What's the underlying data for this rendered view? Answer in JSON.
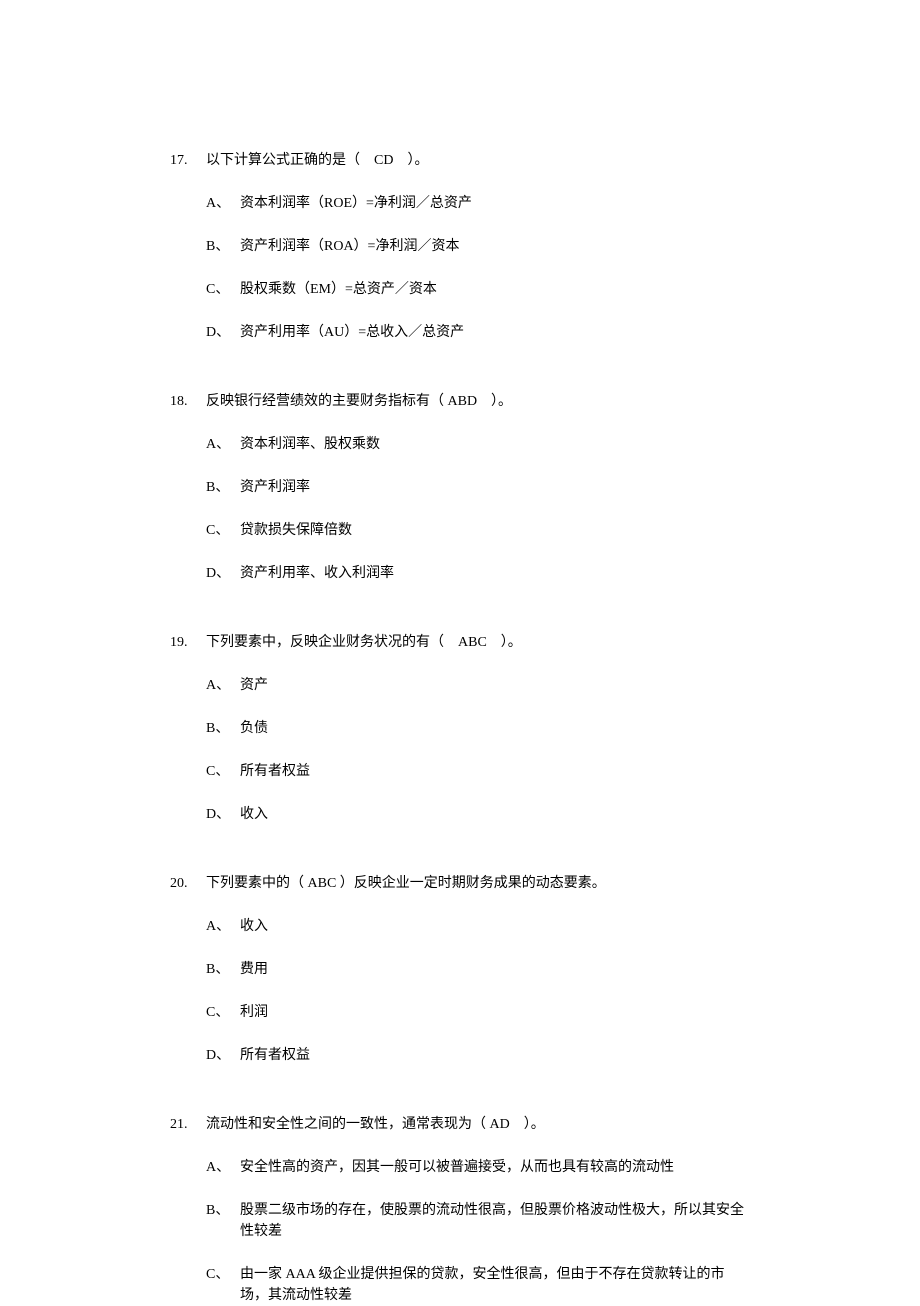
{
  "questions": [
    {
      "number": "17.",
      "stem": "以下计算公式正确的是（　CD　）。",
      "options": [
        {
          "label": "A、",
          "text": "资本利润率（ROE）=净利润／总资产"
        },
        {
          "label": "B、",
          "text": "资产利润率（ROA）=净利润／资本"
        },
        {
          "label": "C、",
          "text": "股权乘数（EM）=总资产／资本"
        },
        {
          "label": "D、",
          "text": "资产利用率（AU）=总收入／总资产"
        }
      ]
    },
    {
      "number": "18.",
      "stem": "反映银行经营绩效的主要财务指标有（ ABD　）。",
      "options": [
        {
          "label": "A、",
          "text": "资本利润率、股权乘数"
        },
        {
          "label": "B、",
          "text": "资产利润率"
        },
        {
          "label": "C、",
          "text": "贷款损失保障倍数"
        },
        {
          "label": "D、",
          "text": "资产利用率、收入利润率"
        }
      ]
    },
    {
      "number": "19.",
      "stem": "下列要素中，反映企业财务状况的有（　ABC　）。",
      "options": [
        {
          "label": "A、",
          "text": "资产"
        },
        {
          "label": "B、",
          "text": "负债"
        },
        {
          "label": "C、",
          "text": "所有者权益"
        },
        {
          "label": "D、",
          "text": "收入"
        }
      ]
    },
    {
      "number": "20.",
      "stem": "下列要素中的（ ABC ）反映企业一定时期财务成果的动态要素。",
      "options": [
        {
          "label": "A、",
          "text": "收入"
        },
        {
          "label": "B、",
          "text": "费用"
        },
        {
          "label": "C、",
          "text": "利润"
        },
        {
          "label": "D、",
          "text": "所有者权益"
        }
      ]
    },
    {
      "number": "21.",
      "stem": "流动性和安全性之间的一致性，通常表现为（ AD　）。",
      "options": [
        {
          "label": "A、",
          "text": "安全性高的资产，因其一般可以被普遍接受，从而也具有较高的流动性"
        },
        {
          "label": "B、",
          "text": "股票二级市场的存在，使股票的流动性很高，但股票价格波动性极大，所以其安全性较差"
        },
        {
          "label": "C、",
          "text": "由一家 AAA 级企业提供担保的贷款，安全性很高，但由于不存在贷款转让的市场，其流动性较差"
        }
      ]
    }
  ]
}
